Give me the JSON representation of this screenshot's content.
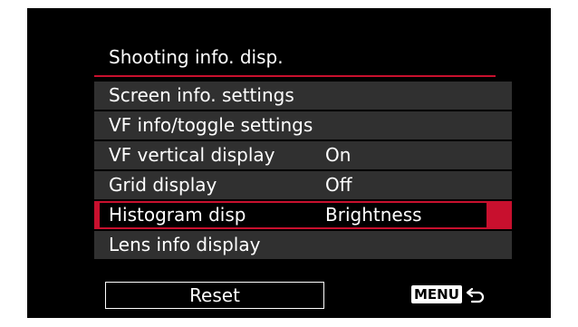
{
  "menu": {
    "title": "Shooting info. disp.",
    "items": [
      {
        "label": "Screen info. settings",
        "value": "",
        "selected": false
      },
      {
        "label": "VF info/toggle settings",
        "value": "",
        "selected": false
      },
      {
        "label": "VF vertical display",
        "value": "On",
        "selected": false
      },
      {
        "label": "Grid display",
        "value": "Off",
        "selected": false
      },
      {
        "label": "Histogram disp",
        "value": "Brightness",
        "selected": true
      },
      {
        "label": "Lens info display",
        "value": "",
        "selected": false
      }
    ]
  },
  "footer": {
    "reset_label": "Reset",
    "menu_key_label": "MENU",
    "return_icon": "return-arrow-icon"
  },
  "colors": {
    "accent": "#c8102e",
    "row_background": "#303030",
    "screen_background": "#000000",
    "text": "#ffffff"
  }
}
